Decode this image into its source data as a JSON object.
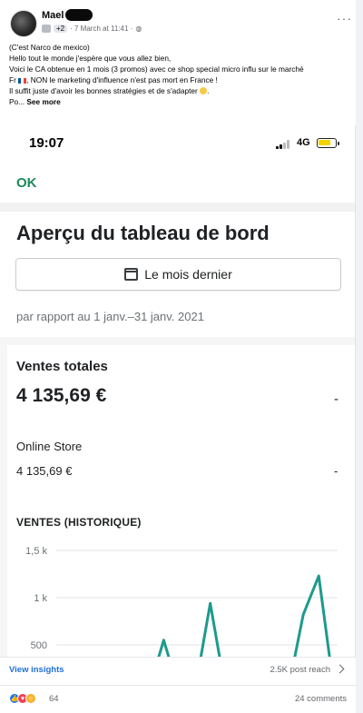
{
  "post": {
    "author": "Mael",
    "meta_plus": "+2",
    "meta_time": "· 7 March at 11:41 ·",
    "menu_icon": "more-horizontal-icon",
    "text_lines": [
      "(C'est Narco de mexico)",
      "Hello tout le monde j'espère que vous allez bien,",
      "Voici le CA obtenue en 1 mois (3 promos) avec ce shop special micro influ sur le marché",
      "Fr",
      ", NON le marketing d'influence n'est pas mort en France !",
      "Il suffit juste d'avoir les bonnes stratégies et de s'adapter",
      "Po...",
      "See more"
    ]
  },
  "phone": {
    "time": "19:07",
    "network": "4G",
    "ok_label": "OK",
    "dashboard_title": "Aperçu du tableau de bord",
    "date_button": "Le mois dernier",
    "compare_text": "par rapport au 1 janv.–31 janv. 2021",
    "total_sales_label": "Ventes totales",
    "total_sales_value": "4 135,69 €",
    "total_sales_change": "-",
    "store_label": "Online Store",
    "store_value": "4 135,69 €",
    "store_change": "-",
    "history_label": "VENTES (HISTORIQUE)"
  },
  "chart_data": {
    "type": "line",
    "title": "VENTES (HISTORIQUE)",
    "y_ticks": [
      "1,5 k",
      "1 k",
      "500"
    ],
    "ylim": [
      500,
      1500
    ],
    "series": [
      {
        "color": "#1d9a8d",
        "points": [
          {
            "x": 1,
            "y": 0
          },
          {
            "x": 2,
            "y": 0
          },
          {
            "x": 3,
            "y": 0
          },
          {
            "x": 4,
            "y": 0
          },
          {
            "x": 5,
            "y": 0
          },
          {
            "x": 6,
            "y": 550
          },
          {
            "x": 7,
            "y": 0
          },
          {
            "x": 8,
            "y": 0
          },
          {
            "x": 9,
            "y": 940
          },
          {
            "x": 10,
            "y": 0
          },
          {
            "x": 11,
            "y": 0
          },
          {
            "x": 12,
            "y": 0
          },
          {
            "x": 13,
            "y": 0
          },
          {
            "x": 14,
            "y": 0
          },
          {
            "x": 15,
            "y": 820
          },
          {
            "x": 16,
            "y": 1230
          },
          {
            "x": 17,
            "y": 0
          }
        ]
      }
    ]
  },
  "footer": {
    "insights_label": "View insights",
    "reach_label": "2.5K post reach",
    "reaction_count": "64",
    "comments_label": "24 comments"
  }
}
